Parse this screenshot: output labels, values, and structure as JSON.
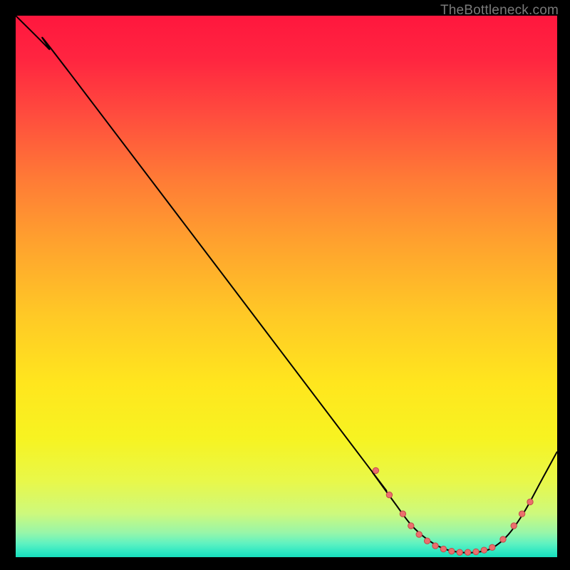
{
  "attribution": "TheBottleneck.com",
  "colors": {
    "gradient_stops": [
      {
        "offset": 0.0,
        "color": "#ff173e"
      },
      {
        "offset": 0.08,
        "color": "#ff2540"
      },
      {
        "offset": 0.18,
        "color": "#ff4b3e"
      },
      {
        "offset": 0.3,
        "color": "#ff7a36"
      },
      {
        "offset": 0.42,
        "color": "#ffa22e"
      },
      {
        "offset": 0.55,
        "color": "#ffc826"
      },
      {
        "offset": 0.68,
        "color": "#ffe61e"
      },
      {
        "offset": 0.78,
        "color": "#f7f321"
      },
      {
        "offset": 0.86,
        "color": "#e8f84a"
      },
      {
        "offset": 0.92,
        "color": "#cdf97d"
      },
      {
        "offset": 0.955,
        "color": "#97f6a9"
      },
      {
        "offset": 0.975,
        "color": "#5ef2c1"
      },
      {
        "offset": 0.99,
        "color": "#2fe8c2"
      },
      {
        "offset": 1.0,
        "color": "#17debc"
      }
    ],
    "curve_stroke": "#000000",
    "marker_fill": "#eb6e6d",
    "marker_stroke": "#c44a49"
  },
  "chart_data": {
    "type": "line",
    "title": "",
    "xlabel": "",
    "ylabel": "",
    "xlim": [
      0,
      100
    ],
    "ylim": [
      0,
      100
    ],
    "curve": [
      {
        "x": 0,
        "y": 100.0
      },
      {
        "x": 6,
        "y": 94.0
      },
      {
        "x": 10,
        "y": 89.4
      },
      {
        "x": 64,
        "y": 18.2
      },
      {
        "x": 66,
        "y": 15.5
      },
      {
        "x": 70,
        "y": 10.0
      },
      {
        "x": 73,
        "y": 6.0
      },
      {
        "x": 76,
        "y": 3.3
      },
      {
        "x": 79,
        "y": 1.6
      },
      {
        "x": 82,
        "y": 0.9
      },
      {
        "x": 85,
        "y": 0.9
      },
      {
        "x": 88,
        "y": 1.7
      },
      {
        "x": 91,
        "y": 4.2
      },
      {
        "x": 94,
        "y": 8.5
      },
      {
        "x": 97,
        "y": 14.0
      },
      {
        "x": 100,
        "y": 19.5
      }
    ],
    "markers": [
      {
        "x": 66.5,
        "y": 16.0
      },
      {
        "x": 69.0,
        "y": 11.5
      },
      {
        "x": 71.5,
        "y": 8.0
      },
      {
        "x": 73.0,
        "y": 5.8
      },
      {
        "x": 74.5,
        "y": 4.2
      },
      {
        "x": 76.0,
        "y": 3.0
      },
      {
        "x": 77.5,
        "y": 2.1
      },
      {
        "x": 79.0,
        "y": 1.5
      },
      {
        "x": 80.5,
        "y": 1.1
      },
      {
        "x": 82.0,
        "y": 0.9
      },
      {
        "x": 83.5,
        "y": 0.9
      },
      {
        "x": 85.0,
        "y": 1.0
      },
      {
        "x": 86.5,
        "y": 1.3
      },
      {
        "x": 88.0,
        "y": 1.8
      },
      {
        "x": 90.0,
        "y": 3.3
      },
      {
        "x": 92.0,
        "y": 5.8
      },
      {
        "x": 93.5,
        "y": 8.0
      },
      {
        "x": 95.0,
        "y": 10.2
      }
    ],
    "marker_radius_pct": 0.55
  }
}
